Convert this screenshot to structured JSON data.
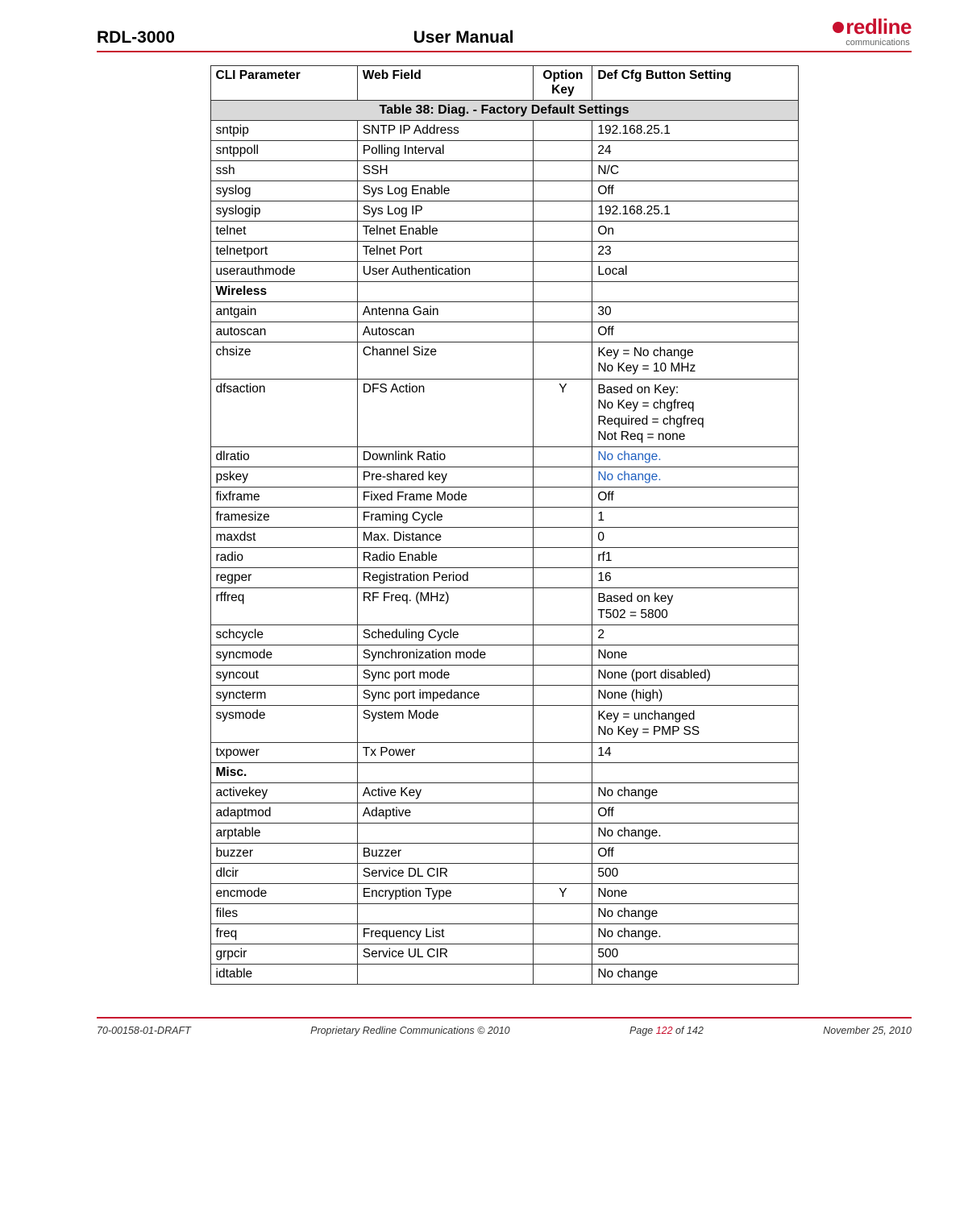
{
  "header": {
    "product": "RDL-3000",
    "title": "User Manual",
    "logo_text": "redline",
    "logo_sub": "communications"
  },
  "table": {
    "title": "Table 38: Diag. - Factory Default Settings",
    "headers": {
      "col1": "CLI Parameter",
      "col2": "Web Field",
      "col3": "Option Key",
      "col4": "Def Cfg Button Setting"
    },
    "rows": [
      {
        "cli": "sntpip",
        "web": "SNTP IP Address",
        "key": "",
        "def": "192.168.25.1"
      },
      {
        "cli": "sntppoll",
        "web": "Polling Interval",
        "key": "",
        "def": "24"
      },
      {
        "cli": "ssh",
        "web": "SSH",
        "key": "",
        "def": "N/C"
      },
      {
        "cli": "syslog",
        "web": "Sys Log Enable",
        "key": "",
        "def": "Off"
      },
      {
        "cli": "syslogip",
        "web": "Sys Log IP",
        "key": "",
        "def": "192.168.25.1"
      },
      {
        "cli": "telnet",
        "web": "Telnet Enable",
        "key": "",
        "def": "On"
      },
      {
        "cli": "telnetport",
        "web": "Telnet Port",
        "key": "",
        "def": "23"
      },
      {
        "cli": "userauthmode",
        "web": "User Authentication",
        "key": "",
        "def": "Local"
      },
      {
        "cli": "Wireless",
        "web": "",
        "key": "",
        "def": "",
        "section": true
      },
      {
        "cli": "antgain",
        "web": "Antenna Gain",
        "key": "",
        "def": "30"
      },
      {
        "cli": "autoscan",
        "web": "Autoscan",
        "key": "",
        "def": "Off"
      },
      {
        "cli": "chsize",
        "web": "Channel Size",
        "key": "",
        "def_lines": [
          "Key = No change",
          "No Key = 10 MHz"
        ]
      },
      {
        "cli": "dfsaction",
        "web": "DFS Action",
        "key": "Y",
        "def_lines": [
          "Based on Key:",
          "No Key = chgfreq",
          "Required = chgfreq",
          "Not Req = none"
        ]
      },
      {
        "cli": "dlratio",
        "web": "Downlink Ratio",
        "key": "",
        "def": "No change.",
        "blue": true
      },
      {
        "cli": "pskey",
        "web": "Pre-shared key",
        "key": "",
        "def": "No change.",
        "blue": true
      },
      {
        "cli": "fixframe",
        "web": "Fixed Frame Mode",
        "key": "",
        "def": "Off"
      },
      {
        "cli": "framesize",
        "web": "Framing Cycle",
        "key": "",
        "def": "1"
      },
      {
        "cli": "maxdst",
        "web": "Max. Distance",
        "key": "",
        "def": "0"
      },
      {
        "cli": "radio",
        "web": "Radio Enable",
        "key": "",
        "def": "rf1"
      },
      {
        "cli": "regper",
        "web": "Registration Period",
        "key": "",
        "def": "16"
      },
      {
        "cli": "rffreq",
        "web": "RF Freq. (MHz)",
        "key": "",
        "def_lines": [
          "Based on key",
          "T502 = 5800"
        ]
      },
      {
        "cli": "schcycle",
        "web": "Scheduling Cycle",
        "key": "",
        "def": "2"
      },
      {
        "cli": "syncmode",
        "web": "Synchronization mode",
        "key": "",
        "def": "None"
      },
      {
        "cli": "syncout",
        "web": "Sync port mode",
        "key": "",
        "def": "None (port disabled)"
      },
      {
        "cli": "syncterm",
        "web": "Sync port impedance",
        "key": "",
        "def": "None (high)"
      },
      {
        "cli": "sysmode",
        "web": "System Mode",
        "key": "",
        "def_lines": [
          "Key = unchanged",
          "No Key = PMP SS"
        ]
      },
      {
        "cli": "txpower",
        "web": "Tx Power",
        "key": "",
        "def": "14"
      },
      {
        "cli": "Misc.",
        "web": "",
        "key": "",
        "def": "",
        "section": true
      },
      {
        "cli": "activekey",
        "web": "Active Key",
        "key": "",
        "def": "No change"
      },
      {
        "cli": "adaptmod",
        "web": "Adaptive",
        "key": "",
        "def": "Off"
      },
      {
        "cli": "arptable",
        "web": "",
        "key": "",
        "def": "No change."
      },
      {
        "cli": "buzzer",
        "web": "Buzzer",
        "key": "",
        "def": "Off"
      },
      {
        "cli": "dlcir",
        "web": "Service DL CIR",
        "key": "",
        "def": "500"
      },
      {
        "cli": "encmode",
        "web": "Encryption Type",
        "key": "Y",
        "def": "None"
      },
      {
        "cli": "files",
        "web": "",
        "key": "",
        "def": "No change"
      },
      {
        "cli": "freq",
        "web": "Frequency List",
        "key": "",
        "def": "No change."
      },
      {
        "cli": "grpcir",
        "web": "Service UL CIR",
        "key": "",
        "def": "500"
      },
      {
        "cli": "idtable",
        "web": "",
        "key": "",
        "def": "No change"
      }
    ]
  },
  "footer": {
    "draft": "70-00158-01-DRAFT",
    "copy": "Proprietary Redline Communications © 2010",
    "page_prefix": "Page ",
    "page_num": "122",
    "page_of": " of 142",
    "date": "November 25, 2010"
  }
}
